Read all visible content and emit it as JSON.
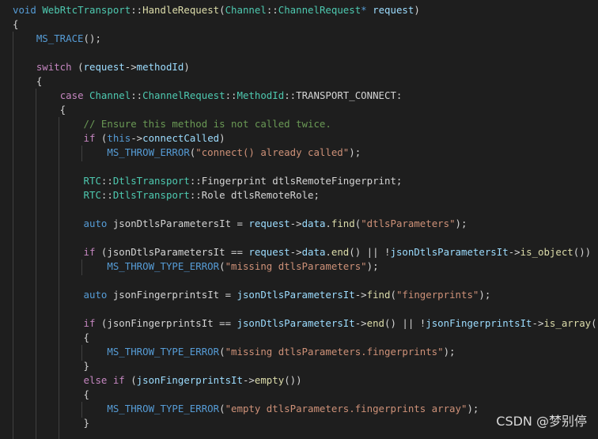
{
  "colors": {
    "background": "#1e1e1e",
    "keyword": "#569cd6",
    "control": "#c586c0",
    "type": "#4ec9b0",
    "function": "#dcdcaa",
    "variable": "#9cdcfe",
    "string": "#ce9178",
    "comment": "#6a9955",
    "plain": "#d4d4d4"
  },
  "code_lines": [
    [
      [
        "kw",
        "void "
      ],
      [
        "type",
        "WebRtcTransport"
      ],
      [
        "op",
        "::"
      ],
      [
        "fn",
        "HandleRequest"
      ],
      [
        "plain",
        "("
      ],
      [
        "type",
        "Channel"
      ],
      [
        "op",
        "::"
      ],
      [
        "type",
        "ChannelRequest"
      ],
      [
        "kw",
        "*"
      ],
      [
        "plain",
        " "
      ],
      [
        "var",
        "request"
      ],
      [
        "plain",
        ")"
      ]
    ],
    [
      [
        "plain",
        "{"
      ]
    ],
    [
      [
        "plain",
        "    "
      ],
      [
        "mac",
        "MS_TRACE"
      ],
      [
        "plain",
        "();"
      ]
    ],
    [],
    [
      [
        "plain",
        "    "
      ],
      [
        "ctl",
        "switch"
      ],
      [
        "plain",
        " ("
      ],
      [
        "var",
        "request"
      ],
      [
        "plain",
        "->"
      ],
      [
        "var",
        "methodId"
      ],
      [
        "plain",
        ")"
      ]
    ],
    [
      [
        "plain",
        "    {"
      ]
    ],
    [
      [
        "plain",
        "        "
      ],
      [
        "ctl",
        "case"
      ],
      [
        "plain",
        " "
      ],
      [
        "type",
        "Channel"
      ],
      [
        "op",
        "::"
      ],
      [
        "type",
        "ChannelRequest"
      ],
      [
        "op",
        "::"
      ],
      [
        "type",
        "MethodId"
      ],
      [
        "op",
        "::"
      ],
      [
        "plain",
        "TRANSPORT_CONNECT:"
      ]
    ],
    [
      [
        "plain",
        "        {"
      ]
    ],
    [
      [
        "plain",
        "            "
      ],
      [
        "cmt",
        "// Ensure this method is not called twice."
      ]
    ],
    [
      [
        "plain",
        "            "
      ],
      [
        "ctl",
        "if"
      ],
      [
        "plain",
        " ("
      ],
      [
        "kw",
        "this"
      ],
      [
        "plain",
        "->"
      ],
      [
        "var",
        "connectCalled"
      ],
      [
        "plain",
        ")"
      ]
    ],
    [
      [
        "plain",
        "                "
      ],
      [
        "mac",
        "MS_THROW_ERROR"
      ],
      [
        "plain",
        "("
      ],
      [
        "str",
        "\"connect() already called\""
      ],
      [
        "plain",
        ");"
      ]
    ],
    [],
    [
      [
        "plain",
        "            "
      ],
      [
        "type",
        "RTC"
      ],
      [
        "op",
        "::"
      ],
      [
        "type",
        "DtlsTransport"
      ],
      [
        "op",
        "::"
      ],
      [
        "plain",
        "Fingerprint dtlsRemoteFingerprint;"
      ]
    ],
    [
      [
        "plain",
        "            "
      ],
      [
        "type",
        "RTC"
      ],
      [
        "op",
        "::"
      ],
      [
        "type",
        "DtlsTransport"
      ],
      [
        "op",
        "::"
      ],
      [
        "plain",
        "Role dtlsRemoteRole;"
      ]
    ],
    [],
    [
      [
        "plain",
        "            "
      ],
      [
        "kw",
        "auto"
      ],
      [
        "plain",
        " jsonDtlsParametersIt = "
      ],
      [
        "var",
        "request"
      ],
      [
        "plain",
        "->"
      ],
      [
        "var",
        "data"
      ],
      [
        "plain",
        "."
      ],
      [
        "fn",
        "find"
      ],
      [
        "plain",
        "("
      ],
      [
        "str",
        "\"dtlsParameters\""
      ],
      [
        "plain",
        ");"
      ]
    ],
    [],
    [
      [
        "plain",
        "            "
      ],
      [
        "ctl",
        "if"
      ],
      [
        "plain",
        " (jsonDtlsParametersIt == "
      ],
      [
        "var",
        "request"
      ],
      [
        "plain",
        "->"
      ],
      [
        "var",
        "data"
      ],
      [
        "plain",
        "."
      ],
      [
        "fn",
        "end"
      ],
      [
        "plain",
        "() || !"
      ],
      [
        "var",
        "jsonDtlsParametersIt"
      ],
      [
        "plain",
        "->"
      ],
      [
        "fn",
        "is_object"
      ],
      [
        "plain",
        "())"
      ]
    ],
    [
      [
        "plain",
        "                "
      ],
      [
        "mac",
        "MS_THROW_TYPE_ERROR"
      ],
      [
        "plain",
        "("
      ],
      [
        "str",
        "\"missing dtlsParameters\""
      ],
      [
        "plain",
        ");"
      ]
    ],
    [],
    [
      [
        "plain",
        "            "
      ],
      [
        "kw",
        "auto"
      ],
      [
        "plain",
        " jsonFingerprintsIt = "
      ],
      [
        "var",
        "jsonDtlsParametersIt"
      ],
      [
        "plain",
        "->"
      ],
      [
        "fn",
        "find"
      ],
      [
        "plain",
        "("
      ],
      [
        "str",
        "\"fingerprints\""
      ],
      [
        "plain",
        ");"
      ]
    ],
    [],
    [
      [
        "plain",
        "            "
      ],
      [
        "ctl",
        "if"
      ],
      [
        "plain",
        " (jsonFingerprintsIt == "
      ],
      [
        "var",
        "jsonDtlsParametersIt"
      ],
      [
        "plain",
        "->"
      ],
      [
        "fn",
        "end"
      ],
      [
        "plain",
        "() || !"
      ],
      [
        "var",
        "jsonFingerprintsIt"
      ],
      [
        "plain",
        "->"
      ],
      [
        "fn",
        "is_array"
      ],
      [
        "plain",
        "())"
      ]
    ],
    [
      [
        "plain",
        "            {"
      ]
    ],
    [
      [
        "plain",
        "                "
      ],
      [
        "mac",
        "MS_THROW_TYPE_ERROR"
      ],
      [
        "plain",
        "("
      ],
      [
        "str",
        "\"missing dtlsParameters.fingerprints\""
      ],
      [
        "plain",
        ");"
      ]
    ],
    [
      [
        "plain",
        "            }"
      ]
    ],
    [
      [
        "plain",
        "            "
      ],
      [
        "ctl",
        "else if"
      ],
      [
        "plain",
        " ("
      ],
      [
        "var",
        "jsonFingerprintsIt"
      ],
      [
        "plain",
        "->"
      ],
      [
        "fn",
        "empty"
      ],
      [
        "plain",
        "())"
      ]
    ],
    [
      [
        "plain",
        "            {"
      ]
    ],
    [
      [
        "plain",
        "                "
      ],
      [
        "mac",
        "MS_THROW_TYPE_ERROR"
      ],
      [
        "plain",
        "("
      ],
      [
        "str",
        "\"empty dtlsParameters.fingerprints array\""
      ],
      [
        "plain",
        ");"
      ]
    ],
    [
      [
        "plain",
        "            }"
      ]
    ]
  ],
  "watermark": "CSDN @梦别停"
}
